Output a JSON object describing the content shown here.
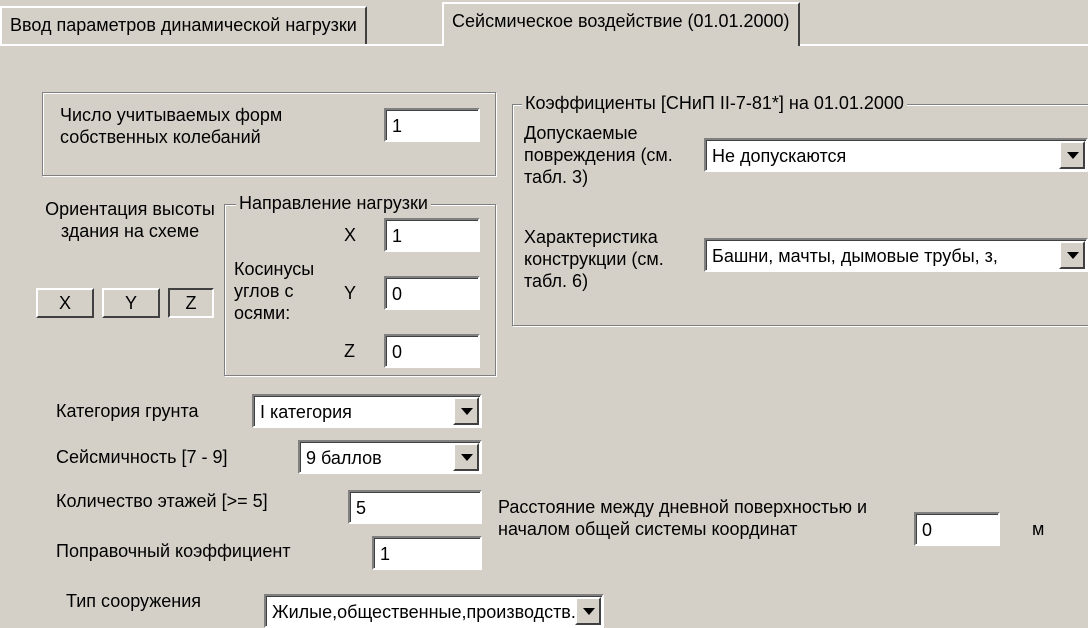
{
  "tabs": [
    {
      "label": "Ввод параметров динамической нагрузки",
      "active": false
    },
    {
      "label": "Сейсмическое воздействие (01.01.2000)",
      "active": true
    }
  ],
  "modes": {
    "label": "Число учитываемых форм собственных колебаний",
    "value": "1"
  },
  "orientation": {
    "label": "Ориентация высоты здания на схеме",
    "buttons": [
      "X",
      "Y",
      "Z"
    ],
    "selected": "Z"
  },
  "direction": {
    "title": "Направление нагрузки",
    "cos_label": "Косинусы углов с осями:",
    "axes": [
      {
        "axis": "X",
        "value": "1"
      },
      {
        "axis": "Y",
        "value": "0"
      },
      {
        "axis": "Z",
        "value": "0"
      }
    ]
  },
  "coefficients": {
    "title": "Коэффициенты [СНиП II-7-81*] на 01.01.2000",
    "damage": {
      "label": "Допускаемые повреждения (см.  табл. 3)",
      "value": "Не допускаются"
    },
    "structure": {
      "label": "Характеристика конструкции (см. табл. 6)",
      "value": "Башни, мачты, дымовые трубы, з,"
    }
  },
  "soil": {
    "label": "Категория грунта",
    "value": "I категория"
  },
  "seismicity": {
    "label": "Сейсмичность [7 - 9]",
    "value": "9 баллов"
  },
  "floors": {
    "label": "Количество этажей [>= 5]",
    "value": "5"
  },
  "correction": {
    "label": "Поправочный коэффициент",
    "value": "1"
  },
  "distance": {
    "label": "Расстояние между дневной поверхностью и началом общей системы координат",
    "value": "0",
    "unit": "м"
  },
  "structure_type": {
    "label": "Тип сооружения",
    "value": "Жилые,общественные,производств."
  },
  "colors": {
    "face": "#d4d0c8",
    "shadow": "#808080",
    "highlight": "#ffffff",
    "window": "#ffffff"
  }
}
